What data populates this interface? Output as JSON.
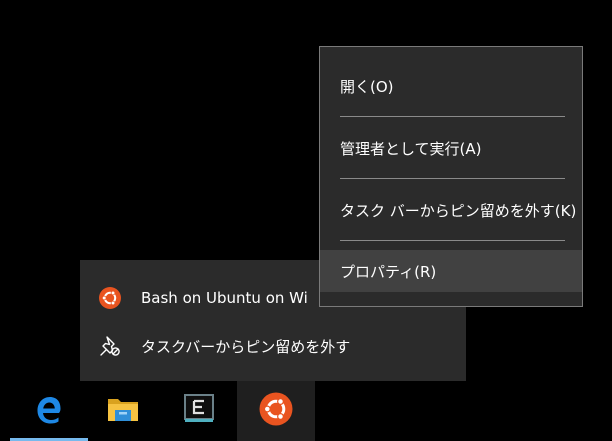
{
  "context_menu": {
    "items": [
      {
        "label": "開く(O)"
      },
      {
        "label": "管理者として実行(A)"
      },
      {
        "label": "タスク バーからピン留めを外す(K)"
      },
      {
        "label": "プロパティ(R)"
      }
    ]
  },
  "jump_list": {
    "app_label": "Bash on Ubuntu on Wi",
    "unpin_label": "タスクバーからピン留めを外す"
  },
  "taskbar": {
    "icons": [
      "edge-icon",
      "file-explorer-icon",
      "terminal-app-icon",
      "ubuntu-icon"
    ]
  },
  "colors": {
    "menu_bg": "#2b2b2b",
    "menu_border": "#7a7a7a",
    "hover_bg": "#414141",
    "ubuntu_orange": "#e95420",
    "edge_blue": "#1e88e5",
    "active_underline": "#76b9ed",
    "folder_yellow": "#f6c342"
  }
}
